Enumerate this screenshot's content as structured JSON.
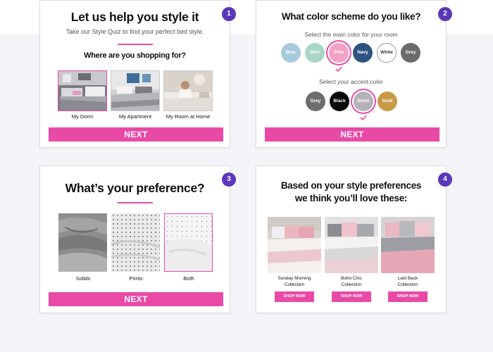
{
  "colors": {
    "accent": "#e84aa6",
    "badge": "#5a38b8"
  },
  "card1": {
    "step": "1",
    "title": "Let us help you style it",
    "subtitle": "Take our Style Quiz to find your perfect bed style.",
    "question": "Where are you shopping for?",
    "options": [
      "My Dorm",
      "My Apartment",
      "My Room at Home"
    ],
    "selected": "My Dorm",
    "next_label": "NEXT"
  },
  "card2": {
    "step": "2",
    "title": "What color scheme do you like?",
    "main_prompt": "Select the main color for your room",
    "main_colors": [
      {
        "label": "Blue",
        "hex": "#a7cbdc"
      },
      {
        "label": "Mint",
        "hex": "#a9d6c7"
      },
      {
        "label": "Pink",
        "hex": "#f4a1c5"
      },
      {
        "label": "Navy",
        "hex": "#2d5480"
      },
      {
        "label": "White",
        "hex": "#ffffff"
      },
      {
        "label": "Grey",
        "hex": "#6b6b6b"
      }
    ],
    "main_selected": "Pink",
    "accent_prompt": "Select your accent color",
    "accent_colors": [
      {
        "label": "Grey",
        "hex": "#6e6e6e"
      },
      {
        "label": "Black",
        "hex": "#0a0a0a"
      },
      {
        "label": "Silver",
        "hex": "#b4b4b8"
      },
      {
        "label": "Gold",
        "hex": "#c99a46"
      }
    ],
    "accent_selected": "Silver",
    "next_label": "NEXT"
  },
  "card3": {
    "step": "3",
    "title": "What’s your preference?",
    "options": [
      "Solids",
      "Prints",
      "Both"
    ],
    "selected": "Both",
    "next_label": "NEXT"
  },
  "card4": {
    "step": "4",
    "title_line1": "Based on your style preferences",
    "title_line2": "we think you’ll love these:",
    "products": [
      {
        "name_line1": "Sunday Morning",
        "name_line2": "Collection",
        "button": "SHOP NOW"
      },
      {
        "name_line1": "Boho Chic",
        "name_line2": "Collection",
        "button": "SHOP NOW"
      },
      {
        "name_line1": "Laid Back",
        "name_line2": "Collection",
        "button": "SHOP NOW"
      }
    ]
  }
}
